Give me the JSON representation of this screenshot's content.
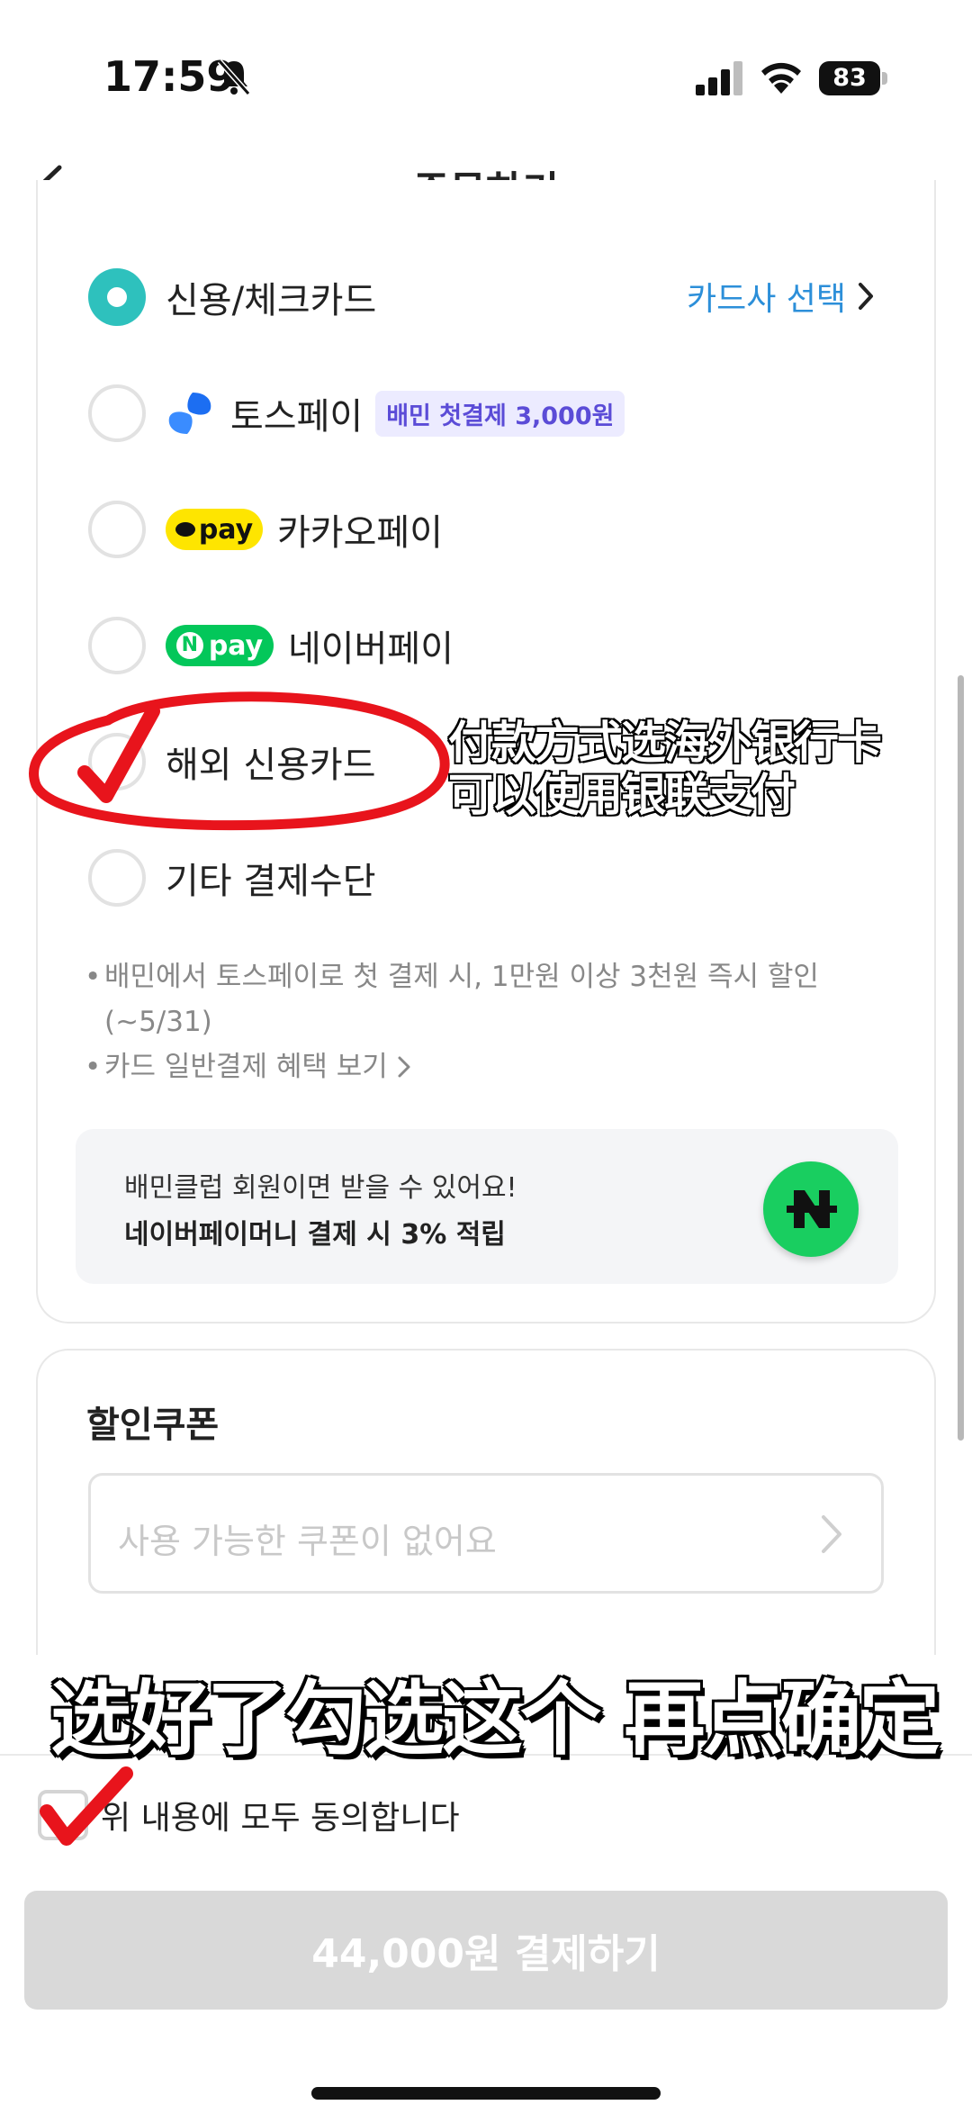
{
  "status_bar": {
    "time": "17:59",
    "battery": "83"
  },
  "header": {
    "title": "주문하기"
  },
  "payment": {
    "card_select_label": "카드사 선택",
    "options": [
      {
        "label": "신용/체크카드",
        "selected": true
      },
      {
        "label": "토스페이",
        "badge": "배민 첫결제 3,000원",
        "selected": false
      },
      {
        "label": "카카오페이",
        "logo_text": "pay",
        "selected": false
      },
      {
        "label": "네이버페이",
        "logo_text": "pay",
        "logo_n": "N",
        "selected": false
      },
      {
        "label": "해외 신용카드",
        "selected": false
      },
      {
        "label": "기타 결제수단",
        "selected": false
      }
    ],
    "notes": [
      "배민에서 토스페이로 첫 결제 시, 1만원 이상 3천원 즉시 할인 (~5/31)",
      "카드 일반결제 혜택 보기"
    ],
    "club_banner": {
      "line1": "배민클럽 회원이면 받을 수 있어요!",
      "line2": "네이버페이머니 결제 시 3% 적립"
    }
  },
  "coupon": {
    "title": "할인쿠폰",
    "placeholder": "사용 가능한 쿠폰이 없어요"
  },
  "bottom": {
    "agree_label": "위 내용에 모두 동의합니다",
    "pay_button": "44,000원 결제하기"
  },
  "annotations": {
    "side_line1": "付款方式选海外银行卡",
    "side_line2": "可以使用银联支付",
    "bottom_text": "选好了勾选这个 再点确定"
  },
  "colors": {
    "accent_teal": "#2ec1bd",
    "link_blue": "#2c8fd9",
    "toss_badge_text": "#5b4cd7",
    "kakao_yellow": "#fee500",
    "naver_green": "#03c75a",
    "annotation_red": "#e8141c",
    "button_disabled": "#d9d9d9"
  }
}
